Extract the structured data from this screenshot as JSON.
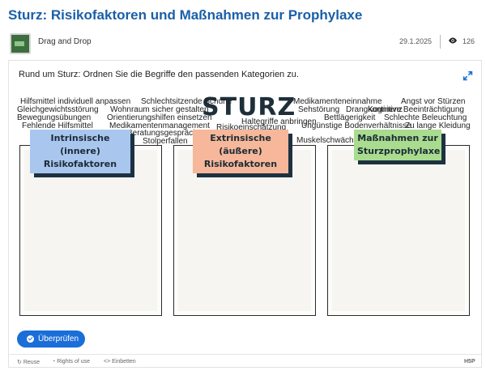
{
  "page": {
    "title": "Sturz: Risikofaktoren und Maßnahmen zur Prophylaxe"
  },
  "meta": {
    "content_type": "Drag and Drop",
    "date": "29.1.2025",
    "views": "126",
    "icons": {
      "eye": "eye-icon",
      "avatar": "thumbnail-icon"
    }
  },
  "task": {
    "instruction": "Rund um Sturz: Ordnen Sie die Begriffe den passenden Kategorien zu.",
    "image_text": "STURZ",
    "terms": [
      "Hilfsmittel individuell anpassen",
      "Schlechtsitzende Schuhe",
      "Medikamenteneinnahme",
      "Angst vor Stürzen",
      "Gleichgewichtsstörung",
      "Wohnraum sicher gestalten",
      "Sehstörung",
      "Drangkontinenz",
      "Kognitive Beeinträchtigung",
      "Bewegungsübungen",
      "Orientierungshilfen einsetzen",
      "Haltegriffe anbringen",
      "Bettlägerigkeit",
      "Schlechte Beleuchtung",
      "Fehlende Hilfsmittel",
      "Medikamentenmanagement",
      "Risikoeinschätzung",
      "Ungünstige Bodenverhältnisse",
      "Zu lange Kleidung",
      "Beratungsgespräche",
      "Stolperfallen",
      "Muskelschwäche"
    ],
    "categories": [
      {
        "label": "Intrinsische (innere) Risikofaktoren",
        "color": "#a9c6ef"
      },
      {
        "label": "Extrinsische (äußere) Risikofaktoren",
        "color": "#f6b79a"
      },
      {
        "label": "Maßnahmen zur Sturzprophylaxe",
        "color": "#a9dc8e"
      }
    ]
  },
  "actions": {
    "check_label": "Überprüfen",
    "accent": "#1a6ed8"
  },
  "footer": {
    "reuse": "Reuse",
    "rights": "Rights of use",
    "embed": "Einbetten",
    "brand": "H5P"
  }
}
